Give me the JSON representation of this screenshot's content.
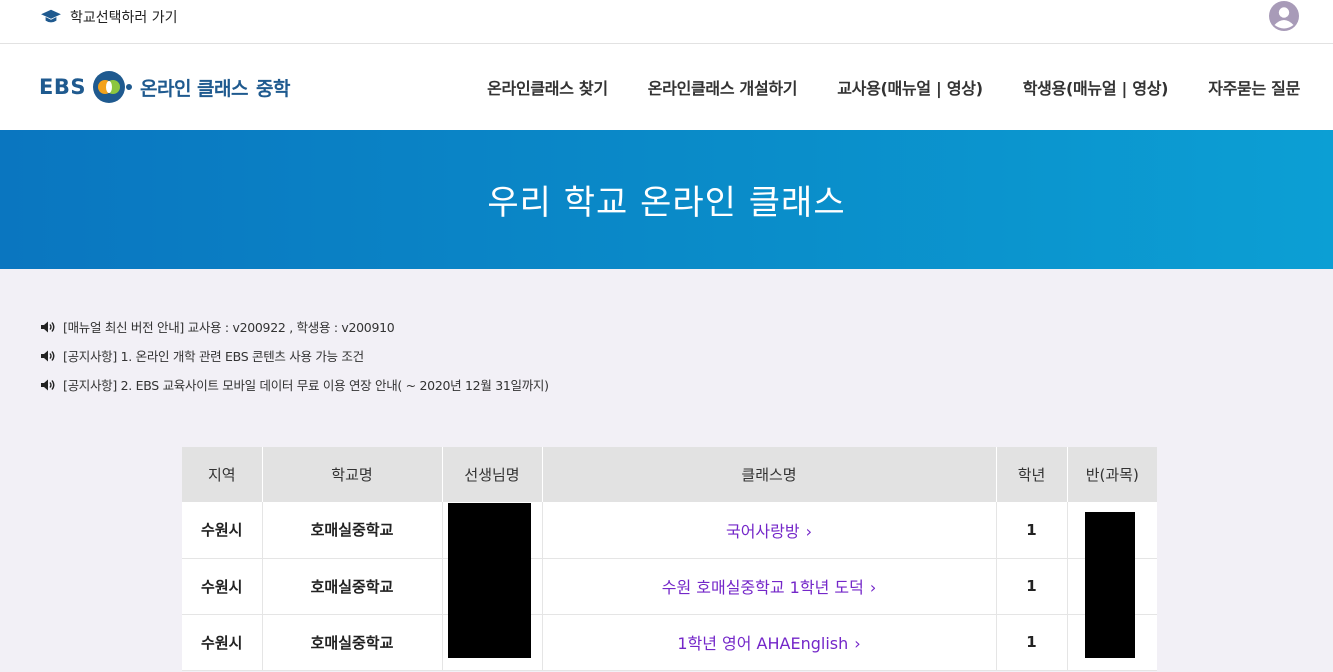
{
  "topbar": {
    "school_link_label": "학교선택하러 가기"
  },
  "logo": {
    "ebs": "EBS",
    "title": "온라인 클래스",
    "level": "중학"
  },
  "nav": {
    "items": [
      {
        "label": "온라인클래스 찾기"
      },
      {
        "label": "온라인클래스 개설하기"
      },
      {
        "label": "교사용(매뉴얼 | 영상)"
      },
      {
        "label": "학생용(매뉴얼 | 영상)"
      },
      {
        "label": "자주묻는 질문"
      }
    ]
  },
  "banner": {
    "title": "우리 학교 온라인 클래스"
  },
  "notices": [
    {
      "text": "[매뉴얼 최신 버전 안내] 교사용 : v200922 , 학생용 : v200910"
    },
    {
      "text": "[공지사항] 1. 온라인 개학 관련 EBS 콘텐츠 사용 가능 조건"
    },
    {
      "text": "[공지사항] 2. EBS 교육사이트 모바일 데이터 무료 이용 연장 안내( ~ 2020년 12월 31일까지)"
    }
  ],
  "table": {
    "headers": [
      "지역",
      "학교명",
      "선생님명",
      "클래스명",
      "학년",
      "반(과목)"
    ],
    "rows": [
      {
        "region": "수원시",
        "school": "호매실중학교",
        "teacher": "",
        "class_name": "국어사랑방",
        "grade": "1",
        "section": ""
      },
      {
        "region": "수원시",
        "school": "호매실중학교",
        "teacher": "",
        "class_name": "수원 호매실중학교 1학년 도덕",
        "grade": "1",
        "section": ""
      },
      {
        "region": "수원시",
        "school": "호매실중학교",
        "teacher": "",
        "class_name": "1학년 영어 AHAEnglish",
        "grade": "1",
        "section": ""
      }
    ]
  },
  "colors": {
    "brand_blue": "#1f5a8f",
    "banner_blue": "#0a8cc9",
    "class_link_purple": "#7427c9",
    "page_background": "#f2f0f6"
  },
  "icons": {
    "school_link": "graduation-cap-icon",
    "user": "user-avatar-icon",
    "notice": "speaker-icon",
    "class_link": "chevron-right-icon"
  }
}
